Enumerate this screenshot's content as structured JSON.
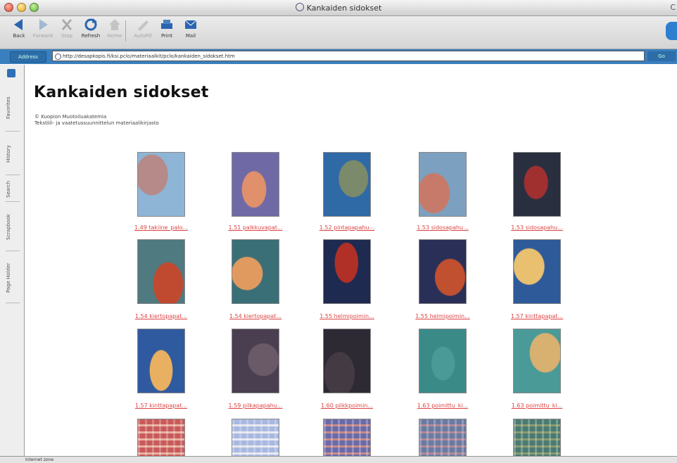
{
  "window": {
    "title": "Kankaiden sidokset",
    "right_char": "C"
  },
  "toolbar": {
    "buttons": [
      {
        "label": "Back",
        "icon": "back-arrow-icon",
        "enabled": true
      },
      {
        "label": "Forward",
        "icon": "forward-arrow-icon",
        "enabled": false
      },
      {
        "label": "Stop",
        "icon": "stop-x-icon",
        "enabled": false
      },
      {
        "label": "Refresh",
        "icon": "refresh-icon",
        "enabled": true
      },
      {
        "label": "Home",
        "icon": "home-icon",
        "enabled": false
      },
      {
        "label": "AutoFill",
        "icon": "autofill-icon",
        "enabled": false
      },
      {
        "label": "Print",
        "icon": "print-icon",
        "enabled": true
      },
      {
        "label": "Mail",
        "icon": "mail-icon",
        "enabled": true
      }
    ]
  },
  "address": {
    "label": "Address",
    "url": "http://desapkopis.fi/ksi.pclo/materiaalkit/pclo/kankaiden_sidokset.htm",
    "go_label": "Go"
  },
  "sidebar": {
    "tabs": [
      "Favorites",
      "History",
      "Search",
      "Scrapbook",
      "Page Holder"
    ]
  },
  "page": {
    "title": "Kankaiden sidokset",
    "subtitle_line1": "© Kuopion Muotoiluakatemia",
    "subtitle_line2": "Tekstiili- ja vaatetussuunnittelun materiaalikirjasto"
  },
  "thumbnails": [
    {
      "caption": "1.49 takiine_palo...",
      "bg": "#8fb5d6",
      "fg": "#b58a88"
    },
    {
      "caption": "1.51 palkkuvapat...",
      "bg": "#6f6aa6",
      "fg": "#e0906a"
    },
    {
      "caption": "1.52 pintapapahu...",
      "bg": "#2f69a6",
      "fg": "#7a8a6a"
    },
    {
      "caption": "1.53 sidosapahu...",
      "bg": "#7ca0c0",
      "fg": "#c77a6a"
    },
    {
      "caption": "1.53 sidosapahu...",
      "bg": "#2a2f40",
      "fg": "#a03030"
    },
    {
      "caption": "1.54 kiertopapat...",
      "bg": "#4f7a80",
      "fg": "#c04a30"
    },
    {
      "caption": "1.54 kiertopapat...",
      "bg": "#3a6f78",
      "fg": "#e09a60"
    },
    {
      "caption": "1.55 helmipoimin...",
      "bg": "#1f2a50",
      "fg": "#b03028"
    },
    {
      "caption": "1.55 helmipoimin...",
      "bg": "#2a2f58",
      "fg": "#c05030"
    },
    {
      "caption": "1.57 kinttapapat...",
      "bg": "#2f5a9a",
      "fg": "#e8c070"
    },
    {
      "caption": "1.57 kinttapapat...",
      "bg": "#2f5aa0",
      "fg": "#e8b060"
    },
    {
      "caption": "1.59 pilkapapahu...",
      "bg": "#4a3f50",
      "fg": "#6a5a68"
    },
    {
      "caption": "1.60 pilkkpoimin...",
      "bg": "#2e2a34",
      "fg": "#443a44"
    },
    {
      "caption": "1.63 poimittu_ki...",
      "bg": "#3a8a88",
      "fg": "#4a9a98"
    },
    {
      "caption": "1.63 poimittu_ki...",
      "bg": "#4a9a98",
      "fg": "#d8b070"
    },
    {
      "caption": "",
      "bg": "#c85a5a",
      "fg": "#e8b0a0"
    },
    {
      "caption": "",
      "bg": "#a8b8e0",
      "fg": "#e8e8f0"
    },
    {
      "caption": "",
      "bg": "#6a6aa8",
      "fg": "#c88a88"
    },
    {
      "caption": "",
      "bg": "#6a7aa0",
      "fg": "#b0889a"
    },
    {
      "caption": "",
      "bg": "#4a7a70",
      "fg": "#8a9a70"
    }
  ],
  "status": {
    "text": "Internet zone"
  }
}
